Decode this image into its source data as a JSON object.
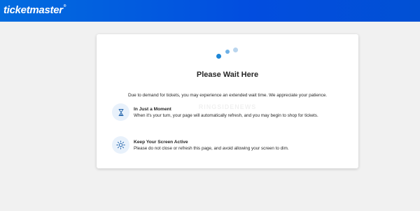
{
  "header": {
    "logo_text": "ticketmaster",
    "logo_mark": "®"
  },
  "card": {
    "title": "Please Wait Here",
    "intro": "Due to demand for tickets, you may experience an extended wait time. We appreciate your patience.",
    "watermark": "RINGSIDENEWS",
    "items": [
      {
        "icon": "hourglass-icon",
        "title": "In Just a Moment",
        "description": "When it's your turn, your page will automatically refresh, and you may begin to shop for tickets."
      },
      {
        "icon": "brightness-icon",
        "title": "Keep Your Screen Active",
        "description": "Please do not close or refresh this page, and avoid allowing your screen to dim."
      }
    ]
  },
  "colors": {
    "brand_blue": "#026cdf",
    "spinner_dark": "#1c86d6",
    "spinner_mid": "#6fb1e6",
    "spinner_light": "#b9d5ee",
    "icon_bg": "#e8f1fb"
  }
}
